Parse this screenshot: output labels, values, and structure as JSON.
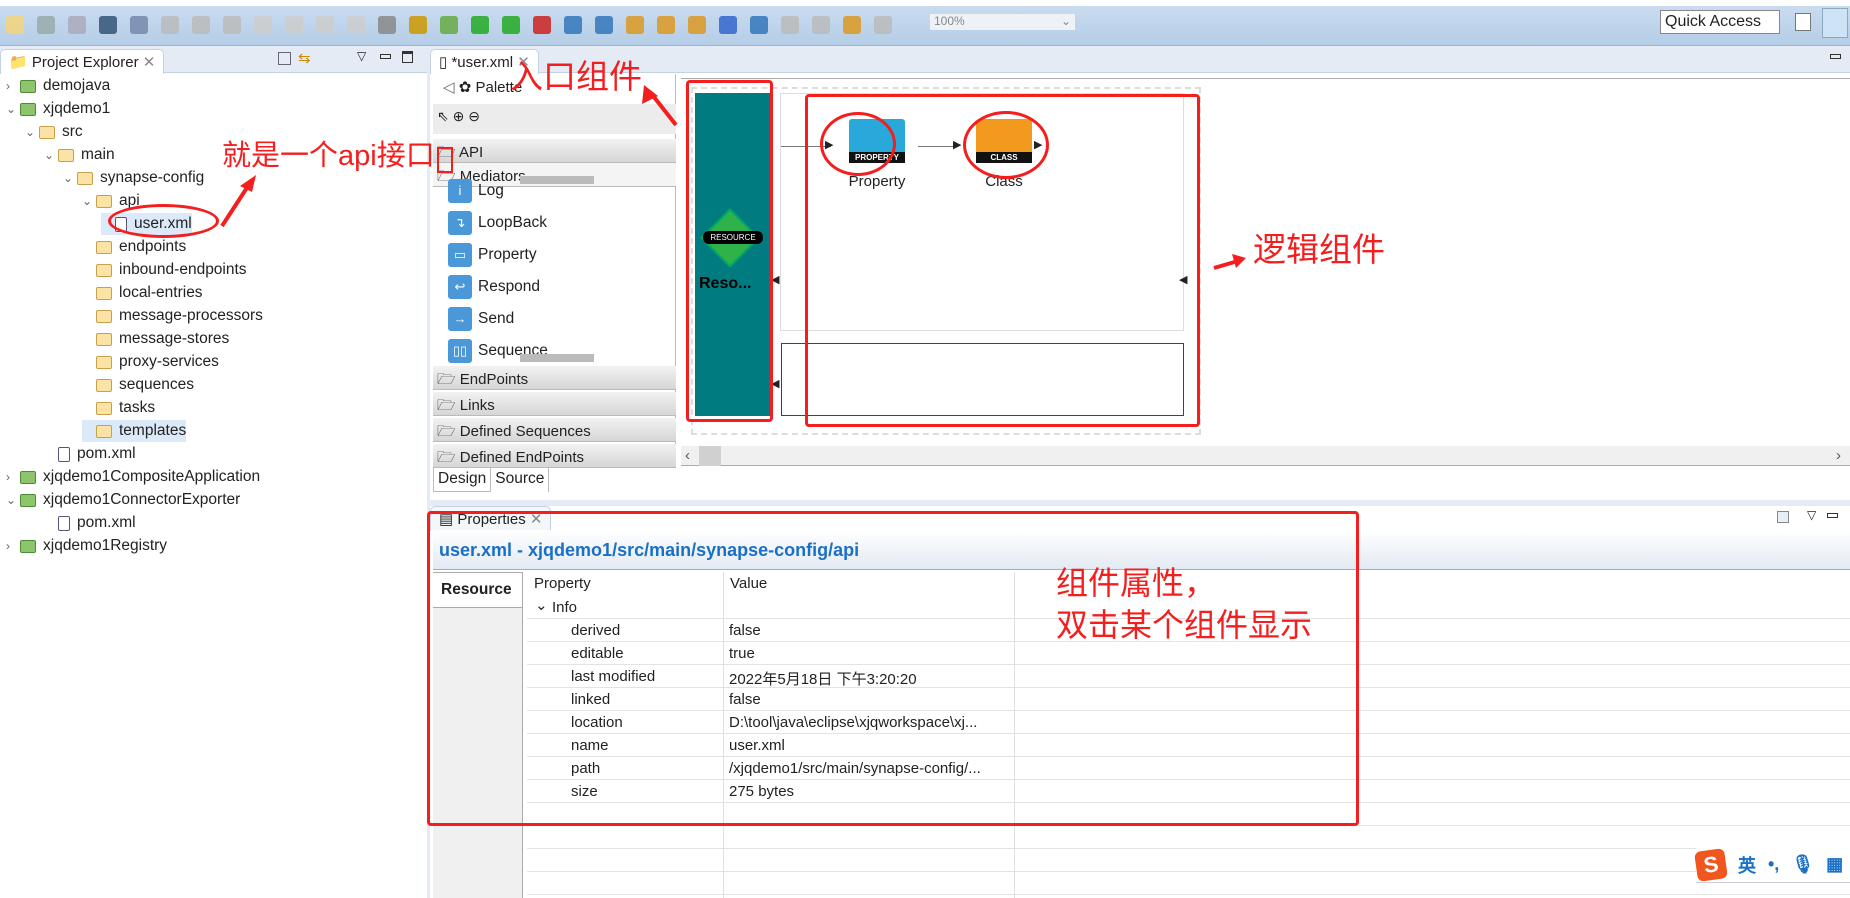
{
  "toolbar": {
    "zoom_value": "100%",
    "quick_access": "Quick Access"
  },
  "explorer": {
    "title": "Project Explorer",
    "items": [
      {
        "label": "demojava",
        "depth": 0,
        "twisty": ">",
        "icon": "java-project-icon"
      },
      {
        "label": "xjqdemo1",
        "depth": 0,
        "twisty": "v",
        "icon": "esb-project-icon"
      },
      {
        "label": "src",
        "depth": 1,
        "twisty": "v",
        "icon": "folder-icon"
      },
      {
        "label": "main",
        "depth": 2,
        "twisty": "v",
        "icon": "folder-icon"
      },
      {
        "label": "synapse-config",
        "depth": 3,
        "twisty": "v",
        "icon": "folder-icon"
      },
      {
        "label": "api",
        "depth": 4,
        "twisty": "v",
        "icon": "folder-icon"
      },
      {
        "label": "user.xml",
        "depth": 5,
        "twisty": "",
        "icon": "xml-file-icon",
        "selected": true
      },
      {
        "label": "endpoints",
        "depth": 4,
        "twisty": "",
        "icon": "folder-icon"
      },
      {
        "label": "inbound-endpoints",
        "depth": 4,
        "twisty": "",
        "icon": "folder-icon"
      },
      {
        "label": "local-entries",
        "depth": 4,
        "twisty": "",
        "icon": "folder-icon"
      },
      {
        "label": "message-processors",
        "depth": 4,
        "twisty": "",
        "icon": "folder-icon"
      },
      {
        "label": "message-stores",
        "depth": 4,
        "twisty": "",
        "icon": "folder-icon"
      },
      {
        "label": "proxy-services",
        "depth": 4,
        "twisty": "",
        "icon": "folder-icon"
      },
      {
        "label": "sequences",
        "depth": 4,
        "twisty": "",
        "icon": "folder-icon"
      },
      {
        "label": "tasks",
        "depth": 4,
        "twisty": "",
        "icon": "folder-icon"
      },
      {
        "label": "templates",
        "depth": 4,
        "twisty": "",
        "icon": "folder-icon",
        "hover": true
      },
      {
        "label": "pom.xml",
        "depth": 2,
        "twisty": "",
        "icon": "maven-file-icon"
      },
      {
        "label": "xjqdemo1CompositeApplication",
        "depth": 0,
        "twisty": ">",
        "icon": "composite-project-icon"
      },
      {
        "label": "xjqdemo1ConnectorExporter",
        "depth": 0,
        "twisty": "v",
        "icon": "connector-project-icon"
      },
      {
        "label": "pom.xml",
        "depth": 2,
        "twisty": "",
        "icon": "maven-file-icon"
      },
      {
        "label": "xjqdemo1Registry",
        "depth": 0,
        "twisty": ">",
        "icon": "registry-project-icon"
      }
    ]
  },
  "editor": {
    "tab": "*user.xml",
    "palette": "Palette",
    "palette_groups_top": [
      "API",
      "Mediators"
    ],
    "mediators": [
      {
        "label": "Log",
        "glyph": "i"
      },
      {
        "label": "LoopBack",
        "glyph": "↴"
      },
      {
        "label": "Property",
        "glyph": "▭"
      },
      {
        "label": "Respond",
        "glyph": "↩"
      },
      {
        "label": "Send",
        "glyph": "→"
      },
      {
        "label": "Sequence",
        "glyph": "▯▯"
      }
    ],
    "palette_groups_bottom": [
      "EndPoints",
      "Links",
      "Defined Sequences",
      "Defined EndPoints"
    ],
    "resource": {
      "badge": "RESOURCE",
      "label": "Reso..."
    },
    "nodes": [
      {
        "badge": "PROPERTY",
        "label": "Property",
        "color": "#29a9d9"
      },
      {
        "badge": "CLASS",
        "label": "Class",
        "color": "#f39a1e"
      }
    ],
    "bottom_tabs": [
      "Design",
      "Source"
    ]
  },
  "properties": {
    "title": "Properties",
    "header": "user.xml - xjqdemo1/src/main/synapse-config/api",
    "side_tab": "Resource",
    "columns": [
      "Property",
      "Value"
    ],
    "group": "Info",
    "rows": [
      [
        "derived",
        "false"
      ],
      [
        "editable",
        "true"
      ],
      [
        "last modified",
        "2022年5月18日 下午3:20:20"
      ],
      [
        "linked",
        "false"
      ],
      [
        "location",
        "D:\\tool\\java\\eclipse\\xjqworkspace\\xj..."
      ],
      [
        "name",
        "user.xml"
      ],
      [
        "path",
        "/xjqdemo1/src/main/synapse-config/..."
      ],
      [
        "size",
        "275  bytes"
      ]
    ]
  },
  "annotations": {
    "api": "就是一个api接口",
    "entry": "入口组件",
    "logic": "逻辑组件",
    "props_line1": "组件属性，",
    "props_line2": "双击某个组件显示"
  },
  "ime": {
    "lang": "英",
    "punct": "•,"
  },
  "colors": {
    "annotation": "#f41e1e",
    "resource_block": "#007b80",
    "header_link": "#1a6fc6"
  }
}
